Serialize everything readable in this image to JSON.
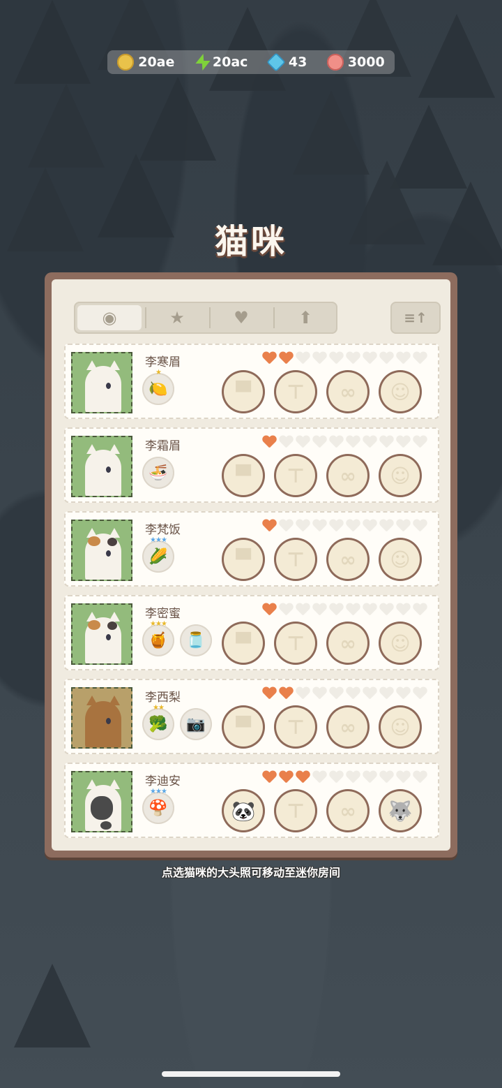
{
  "resources": [
    {
      "icon": "gold-coin-icon",
      "value": "20ae"
    },
    {
      "icon": "energy-bolt-icon",
      "value": "20ac"
    },
    {
      "icon": "gem-icon",
      "value": "43"
    },
    {
      "icon": "fish-cookie-icon",
      "value": "3000"
    }
  ],
  "title": "猫咪",
  "tabs": [
    {
      "icon": "cat-face-icon",
      "glyph": "◉",
      "active": true
    },
    {
      "icon": "star-icon",
      "glyph": "★",
      "active": false
    },
    {
      "icon": "heart-icon",
      "glyph": "♥",
      "active": false
    },
    {
      "icon": "arrow-up-icon",
      "glyph": "⬆",
      "active": false
    }
  ],
  "sort_button": {
    "icon": "sort-icon",
    "glyph": "≡↑"
  },
  "cats": [
    {
      "name": "李寒眉",
      "hearts": 2,
      "max_hearts": 10,
      "coat": "white",
      "items": [
        {
          "icon": "lemon-dish-icon",
          "glyph": "🍋",
          "stars": "★",
          "star_color": "gold"
        }
      ],
      "slots": [
        "hat-slot",
        "shirt-slot",
        "glasses-slot",
        "pet-slot"
      ]
    },
    {
      "name": "李霜眉",
      "hearts": 1,
      "max_hearts": 10,
      "coat": "white",
      "items": [
        {
          "icon": "noodle-bowl-icon",
          "glyph": "🍜",
          "stars": "",
          "star_color": "gold"
        }
      ],
      "slots": [
        "hat-slot",
        "shirt-slot",
        "glasses-slot",
        "pet-slot"
      ]
    },
    {
      "name": "李梵饭",
      "hearts": 1,
      "max_hearts": 10,
      "coat": "calico",
      "items": [
        {
          "icon": "corn-icon",
          "glyph": "🌽",
          "stars": "★★★",
          "star_color": "blue"
        }
      ],
      "slots": [
        "hat-slot",
        "shirt-slot",
        "glasses-slot",
        "pet-slot"
      ]
    },
    {
      "name": "李密蜜",
      "hearts": 1,
      "max_hearts": 10,
      "coat": "calico",
      "items": [
        {
          "icon": "honeycomb-icon",
          "glyph": "🍯",
          "stars": "★★★",
          "star_color": "gold"
        },
        {
          "icon": "jam-jar-icon",
          "glyph": "🫙",
          "stars": "",
          "star_color": "gold"
        }
      ],
      "slots": [
        "hat-slot",
        "shirt-slot",
        "glasses-slot",
        "pet-slot"
      ]
    },
    {
      "name": "李西梨",
      "hearts": 2,
      "max_hearts": 10,
      "coat": "brown",
      "items": [
        {
          "icon": "broccoli-icon",
          "glyph": "🥦",
          "stars": "★★",
          "star_color": "gold"
        },
        {
          "icon": "camera-icon",
          "glyph": "📷",
          "stars": "",
          "star_color": "gold"
        }
      ],
      "slots": [
        "hat-slot",
        "shirt-slot",
        "glasses-slot",
        "pet-slot"
      ]
    },
    {
      "name": "李迪安",
      "hearts": 3,
      "max_hearts": 10,
      "coat": "panda",
      "items": [
        {
          "icon": "mushroom-icon",
          "glyph": "🍄",
          "stars": "★★★",
          "star_color": "blue"
        }
      ],
      "slots": [
        "panda-hat-filled",
        "shirt-slot",
        "glasses-slot",
        "husky-pet-filled"
      ]
    }
  ],
  "hint": "点选猫咪的大头照可移动至迷你房间",
  "colors": {
    "heart_full": "#e9804b",
    "heart_empty": "#efece5",
    "panel_border": "#8d6c5e",
    "panel_bg": "#f0ebe0"
  }
}
